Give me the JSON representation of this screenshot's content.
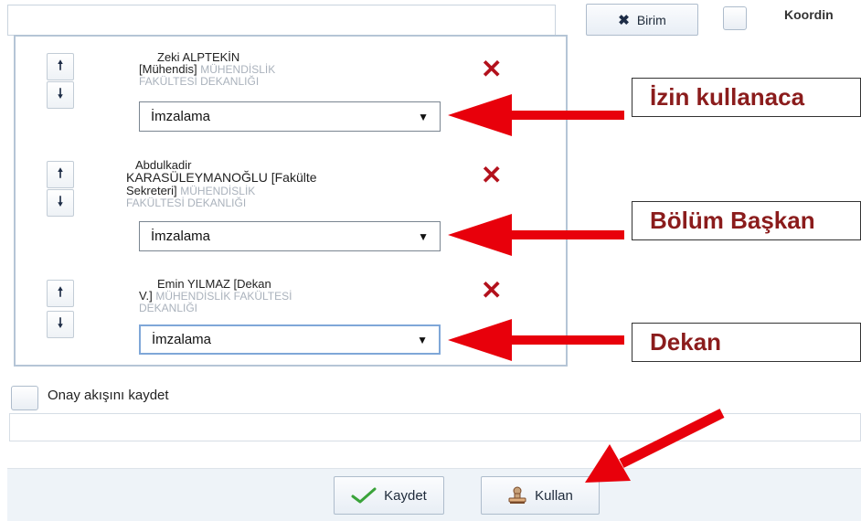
{
  "toolbar": {
    "search_value": "",
    "birim_button": {
      "icon": "close-icon",
      "label": "Birim"
    },
    "koordinator_label": "Koordin"
  },
  "signers": [
    {
      "name_lines": [
        "Zeki ALPTEKİN",
        "[Mühendis]"
      ],
      "unit_inline": "MÜHENDİSLİK",
      "unit_lines": [
        "FAKÜLTESİ DEKANLIĞI"
      ],
      "action": "İmzalama"
    },
    {
      "name_lines": [
        "Abdulkadir",
        "KARASÜLEYMANOĞLU [Fakülte",
        "Sekreteri]"
      ],
      "unit_inline": "MÜHENDİSLİK",
      "unit_lines": [
        "FAKÜLTESİ DEKANLIĞI"
      ],
      "action": "İmzalama"
    },
    {
      "name_lines": [
        "Emin YILMAZ [Dekan",
        "V.]"
      ],
      "unit_inline": "MÜHENDİSLİK FAKÜLTESİ",
      "unit_lines": [
        "DEKANLIĞI"
      ],
      "action": "İmzalama"
    }
  ],
  "annotations": {
    "callout_1": "İzin kullanaca",
    "callout_2": "Bölüm Başkan",
    "callout_3": "Dekan",
    "arrow_color": "#e8000b"
  },
  "onay_label": "Onay akışını kaydet",
  "onay_checked": false,
  "footer": {
    "save_label": "Kaydet",
    "use_label": "Kullan"
  },
  "colors": {
    "remove": "#b3111c",
    "callout_text": "#8b1c1c",
    "panel_border": "#b5c5d6"
  }
}
